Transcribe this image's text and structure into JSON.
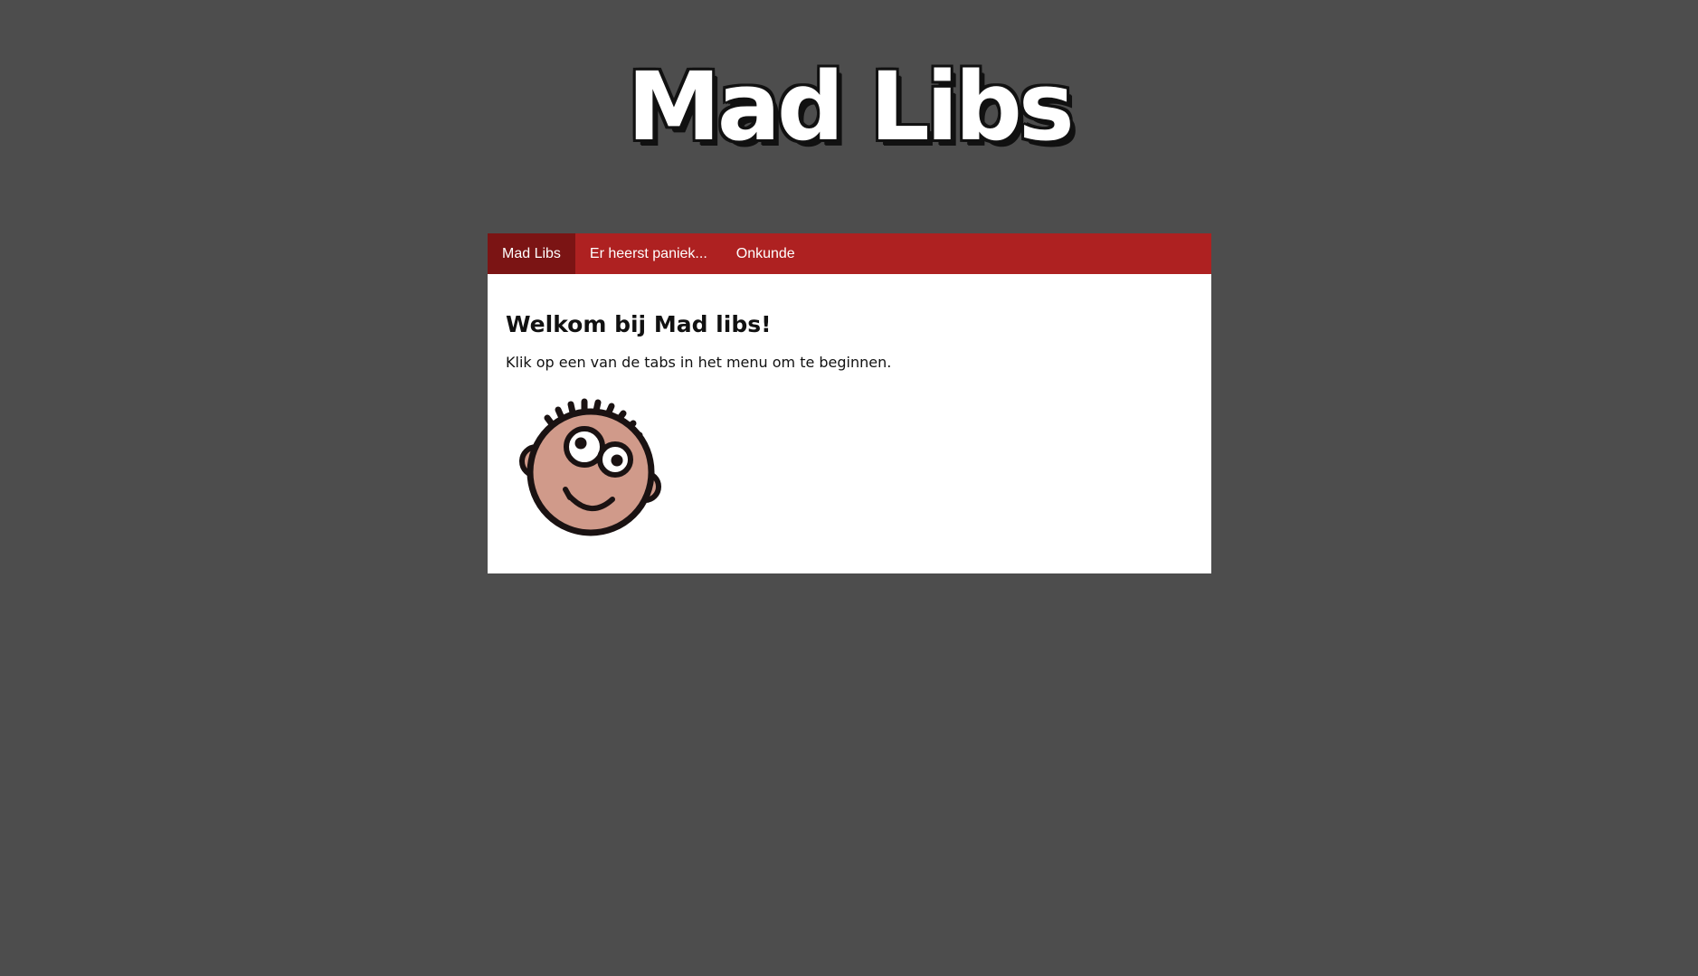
{
  "header": {
    "logo_text": "Mad Libs"
  },
  "nav": {
    "tabs": [
      {
        "label": "Mad Libs",
        "active": true
      },
      {
        "label": "Er heerst paniek...",
        "active": false
      },
      {
        "label": "Onkunde",
        "active": false
      }
    ]
  },
  "main": {
    "heading": "Welkom bij Mad libs!",
    "intro": "Klik op een van de tabs in het menu om te beginnen.",
    "image_icon": "cartoon-face-icon"
  },
  "colors": {
    "background": "#4d4d4d",
    "nav_bar": "#ae2121",
    "nav_active": "#7b1414",
    "skin": "#d09a8a"
  }
}
